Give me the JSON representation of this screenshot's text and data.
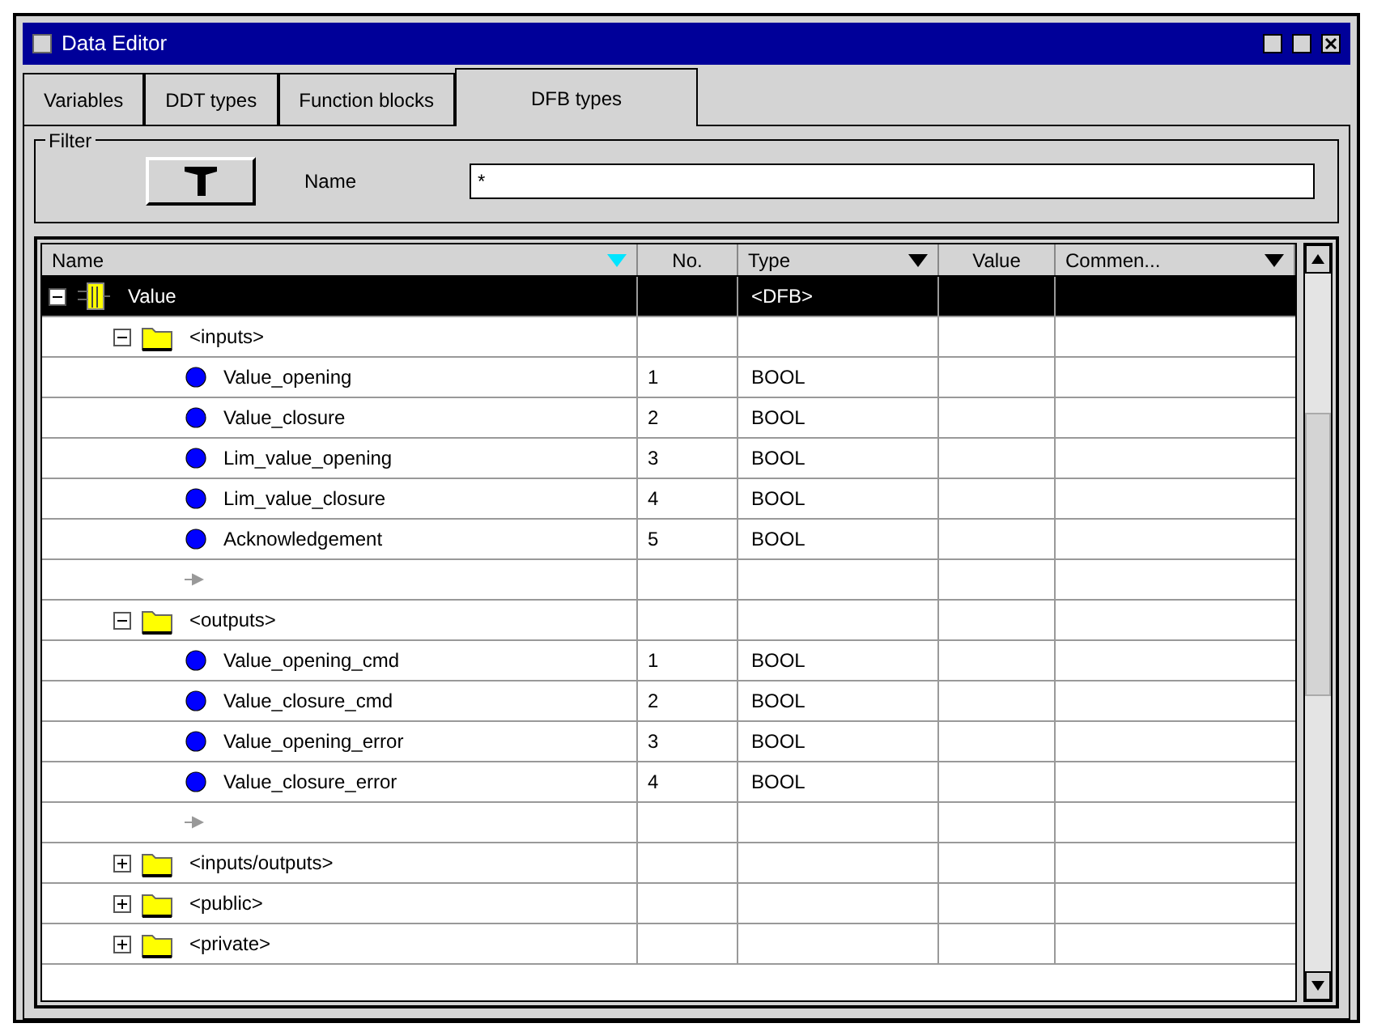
{
  "window": {
    "title": "Data Editor"
  },
  "tabs": [
    {
      "label": "Variables",
      "selected": false
    },
    {
      "label": "DDT types",
      "selected": false
    },
    {
      "label": "Function blocks",
      "selected": false
    },
    {
      "label": "DFB types",
      "selected": true
    }
  ],
  "filter": {
    "legend": "Filter",
    "name_label": "Name",
    "name_value": "*"
  },
  "table": {
    "columns": [
      {
        "label": "Name",
        "kind": "sorted"
      },
      {
        "label": "No.",
        "kind": "plain"
      },
      {
        "label": "Type",
        "kind": "dropdown"
      },
      {
        "label": "Value",
        "kind": "plain"
      },
      {
        "label": "Commen...",
        "kind": "dropdown"
      }
    ],
    "tree": [
      {
        "kind": "dfb",
        "name": "Value",
        "type": "<DFB>",
        "selected": true,
        "expanded": true,
        "children": [
          {
            "kind": "folder",
            "name": "<inputs>",
            "selected": false,
            "expanded": true,
            "children": [
              {
                "kind": "variable",
                "name": "Value_opening",
                "no": "1",
                "type": "BOOL",
                "selected": false
              },
              {
                "kind": "variable",
                "name": "Value_closure",
                "no": "2",
                "type": "BOOL",
                "selected": false
              },
              {
                "kind": "variable",
                "name": "Lim_value_opening",
                "no": "3",
                "type": "BOOL",
                "selected": false
              },
              {
                "kind": "variable",
                "name": "Lim_value_closure",
                "no": "4",
                "type": "BOOL",
                "selected": false
              },
              {
                "kind": "variable",
                "name": "Acknowledgement",
                "no": "5",
                "type": "BOOL",
                "selected": false
              },
              {
                "kind": "new",
                "selected": false
              }
            ]
          },
          {
            "kind": "folder",
            "name": "<outputs>",
            "selected": false,
            "expanded": true,
            "children": [
              {
                "kind": "variable",
                "name": "Value_opening_cmd",
                "no": "1",
                "type": "BOOL",
                "selected": false
              },
              {
                "kind": "variable",
                "name": "Value_closure_cmd",
                "no": "2",
                "type": "BOOL",
                "selected": false
              },
              {
                "kind": "variable",
                "name": "Value_opening_error",
                "no": "3",
                "type": "BOOL",
                "selected": false
              },
              {
                "kind": "variable",
                "name": "Value_closure_error",
                "no": "4",
                "type": "BOOL",
                "selected": false
              },
              {
                "kind": "new",
                "selected": false
              }
            ]
          },
          {
            "kind": "folder",
            "name": "<inputs/outputs>",
            "selected": false,
            "expanded": false
          },
          {
            "kind": "folder",
            "name": "<public>",
            "selected": false,
            "expanded": false
          },
          {
            "kind": "folder",
            "name": "<private>",
            "selected": false,
            "expanded": false
          }
        ]
      }
    ]
  }
}
